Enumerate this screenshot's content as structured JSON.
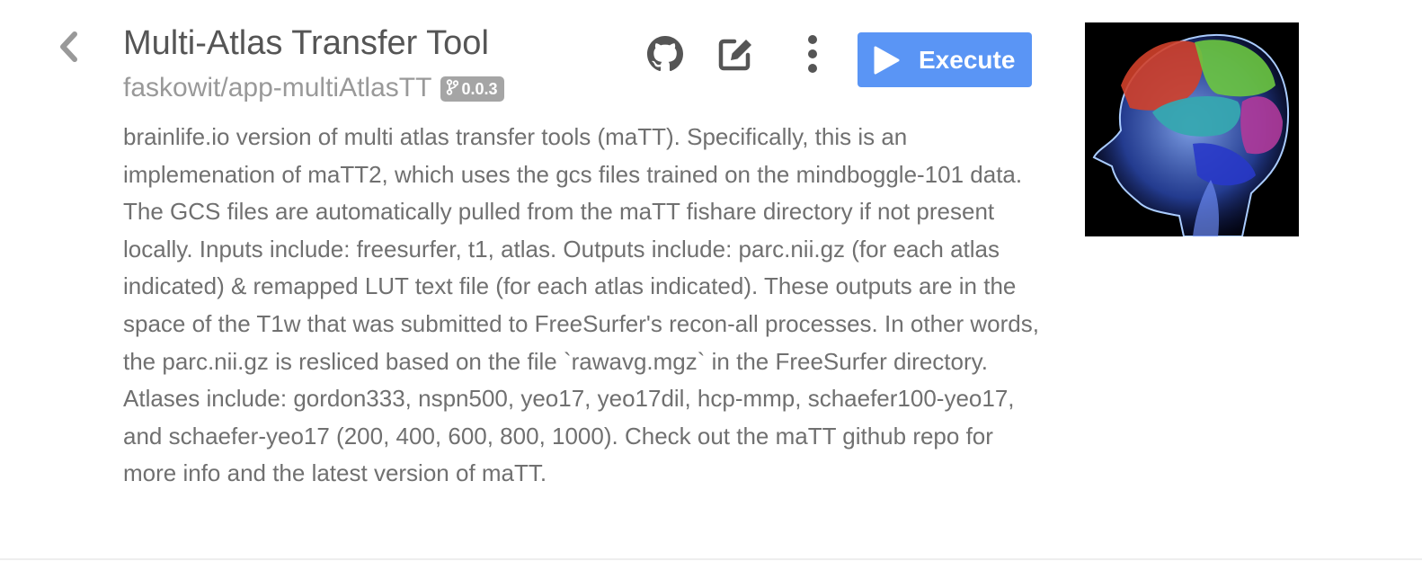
{
  "app": {
    "title": "Multi-Atlas Transfer Tool",
    "repository": "faskowit/app-multiAtlasTT",
    "version": "0.0.3",
    "description": "brainlife.io version of multi atlas transfer tools (maTT). Specifically, this is an implemenation of maTT2, which uses the gcs files trained on the mindboggle-101 data. The GCS files are automatically pulled from the maTT fishare directory if not present locally. Inputs include: freesurfer, t1, atlas. Outputs include: parc.nii.gz (for each atlas indicated) & remapped LUT text file (for each atlas indicated). These outputs are in the space of the T1w that was submitted to FreeSurfer's recon-all processes. In other words, the parc.nii.gz is resliced based on the file `rawavg.mgz` in the FreeSurfer directory. Atlases include: gordon333, nspn500, yeo17, yeo17dil, hcp-mmp, schaefer100-yeo17, and schaefer-yeo17 (200, 400, 600, 800, 1000). Check out the maTT github repo for more info and the latest version of maTT."
  },
  "toolbar": {
    "execute_label": "Execute",
    "icons": [
      "chevron-left-icon",
      "github-icon",
      "edit-icon",
      "ellipsis-vertical-icon",
      "play-icon",
      "code-branch-icon"
    ]
  },
  "colors": {
    "execute_button": "#5a95f5",
    "version_badge": "#a5a5a5",
    "title_text": "#555555",
    "muted_text": "#999999",
    "icon": "#555555"
  }
}
